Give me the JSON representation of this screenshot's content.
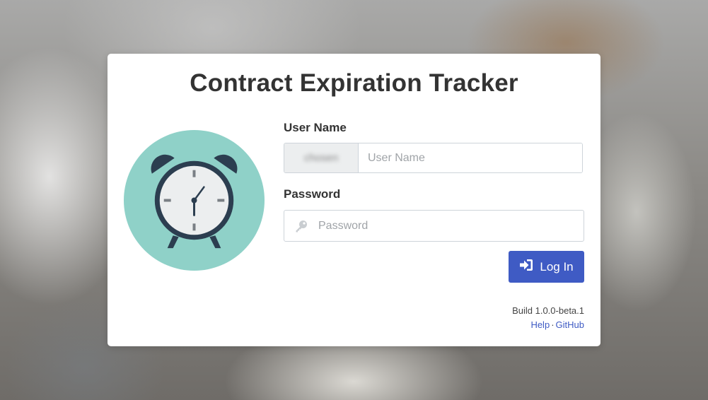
{
  "app": {
    "title": "Contract Expiration Tracker"
  },
  "form": {
    "username_label": "User Name",
    "username_prefix": "chosen",
    "username_placeholder": "User Name",
    "username_value": "",
    "password_label": "Password",
    "password_placeholder": "Password",
    "password_value": "",
    "login_label": "Log In"
  },
  "footer": {
    "build": "Build 1.0.0-beta.1",
    "help_label": "Help",
    "separator": "·",
    "github_label": "GitHub"
  },
  "icons": {
    "logo": "alarm-clock-icon",
    "password": "key-icon",
    "login": "sign-in-icon"
  },
  "colors": {
    "primary": "#3f5bc4",
    "logo_circle": "#8fd1c8",
    "clock_dark": "#2c3e50",
    "clock_face": "#eceeef"
  }
}
